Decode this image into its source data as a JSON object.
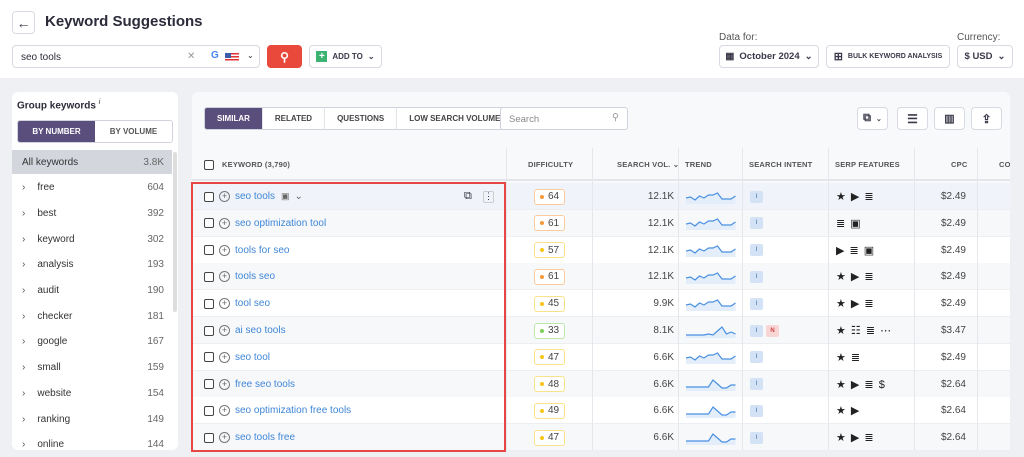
{
  "header": {
    "title": "Keyword Suggestions",
    "search_value": "seo tools",
    "add_to": "ADD TO",
    "data_for_label": "Data for:",
    "date": "October 2024",
    "bulk": "BULK KEYWORD ANALYSIS",
    "currency_label": "Currency:",
    "currency": "$ USD"
  },
  "sidebar": {
    "title": "Group keywords",
    "info": "i",
    "by_number": "BY NUMBER",
    "by_volume": "BY VOLUME",
    "items": [
      {
        "label": "All keywords",
        "count": "3.8K"
      },
      {
        "label": "free",
        "count": "604"
      },
      {
        "label": "best",
        "count": "392"
      },
      {
        "label": "keyword",
        "count": "302"
      },
      {
        "label": "analysis",
        "count": "193"
      },
      {
        "label": "audit",
        "count": "190"
      },
      {
        "label": "checker",
        "count": "181"
      },
      {
        "label": "google",
        "count": "167"
      },
      {
        "label": "small",
        "count": "159"
      },
      {
        "label": "website",
        "count": "154"
      },
      {
        "label": "ranking",
        "count": "149"
      },
      {
        "label": "online",
        "count": "144"
      }
    ]
  },
  "tabs": [
    "SIMILAR",
    "RELATED",
    "QUESTIONS",
    "LOW SEARCH VOLUME"
  ],
  "table_search_placeholder": "Search",
  "columns": {
    "keyword": "KEYWORD",
    "keyword_count": "(3,790)",
    "difficulty": "DIFFICULTY",
    "volume": "SEARCH VOL.",
    "trend": "TREND",
    "intent": "SEARCH INTENT",
    "serp": "SERP FEATURES",
    "cpc": "CPC",
    "com": "COM"
  },
  "colors": {
    "accent": "#5a4f7c",
    "search_btn": "#e8493a",
    "link": "#3f86d6",
    "highlight": "#e84545",
    "diff_orange": "#f59a3c",
    "diff_yellow": "#f5c518",
    "diff_green": "#7ed05a"
  },
  "rows": [
    {
      "keyword": "seo tools",
      "difficulty": "64",
      "level": "orange",
      "volume": "12.1K",
      "trend": "wave",
      "intent": [
        "I"
      ],
      "serp": "★ ▶ ≣",
      "cpc": "$2.49"
    },
    {
      "keyword": "seo optimization tool",
      "difficulty": "61",
      "level": "orange",
      "volume": "12.1K",
      "trend": "wave",
      "intent": [
        "I"
      ],
      "serp": "≣ ▣",
      "cpc": "$2.49"
    },
    {
      "keyword": "tools for seo",
      "difficulty": "57",
      "level": "yellow",
      "volume": "12.1K",
      "trend": "wave",
      "intent": [
        "I"
      ],
      "serp": "▶ ≣ ▣",
      "cpc": "$2.49"
    },
    {
      "keyword": "tools seo",
      "difficulty": "61",
      "level": "orange",
      "volume": "12.1K",
      "trend": "wave",
      "intent": [
        "I"
      ],
      "serp": "★ ▶ ≣",
      "cpc": "$2.49"
    },
    {
      "keyword": "tool seo",
      "difficulty": "45",
      "level": "yellow",
      "volume": "9.9K",
      "trend": "wave",
      "intent": [
        "I"
      ],
      "serp": "★ ▶ ≣",
      "cpc": "$2.49"
    },
    {
      "keyword": "ai seo tools",
      "difficulty": "33",
      "level": "green",
      "volume": "8.1K",
      "trend": "spike",
      "intent": [
        "I",
        "N"
      ],
      "serp": "★ ☷ ≣ ⋯",
      "cpc": "$3.47"
    },
    {
      "keyword": "seo tool",
      "difficulty": "47",
      "level": "yellow",
      "volume": "6.6K",
      "trend": "wave",
      "intent": [
        "I"
      ],
      "serp": "★ ≣",
      "cpc": "$2.49"
    },
    {
      "keyword": "free seo tools",
      "difficulty": "48",
      "level": "yellow",
      "volume": "6.6K",
      "trend": "peak",
      "intent": [
        "I"
      ],
      "serp": "★ ▶ ≣ $",
      "cpc": "$2.64"
    },
    {
      "keyword": "seo optimization free tools",
      "difficulty": "49",
      "level": "yellow",
      "volume": "6.6K",
      "trend": "peak",
      "intent": [
        "I"
      ],
      "serp": "★ ▶",
      "cpc": "$2.64"
    },
    {
      "keyword": "seo tools free",
      "difficulty": "47",
      "level": "yellow",
      "volume": "6.6K",
      "trend": "peak",
      "intent": [
        "I"
      ],
      "serp": "★ ▶ ≣",
      "cpc": "$2.64"
    }
  ]
}
